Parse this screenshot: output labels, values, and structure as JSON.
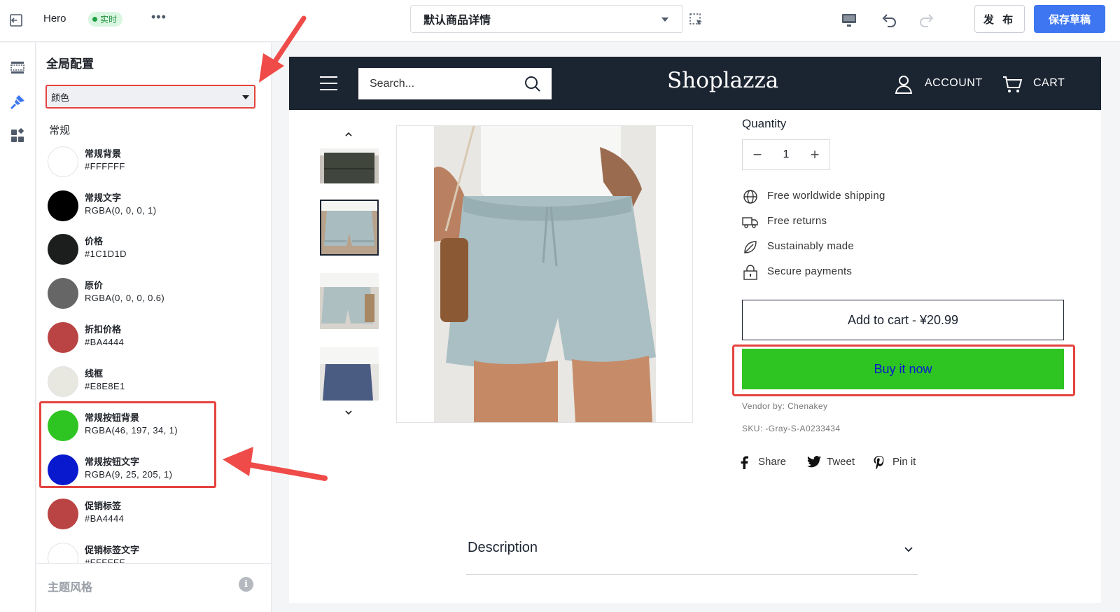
{
  "topbar": {
    "theme_name": "Hero",
    "live_badge": "实时",
    "more": "•••",
    "page_select": "默认商品详情",
    "publish_label": "发 布",
    "save_label": "保存草稿"
  },
  "panel": {
    "title": "全局配置",
    "section_select": "颜色",
    "group_label": "常规",
    "colors": [
      {
        "name": "常规背景",
        "value": "#FFFFFF",
        "swatch": "#FFFFFF"
      },
      {
        "name": "常规文字",
        "value": "RGBA(0, 0, 0, 1)",
        "swatch": "#000000"
      },
      {
        "name": "价格",
        "value": "#1C1D1D",
        "swatch": "#1C1D1D"
      },
      {
        "name": "原价",
        "value": "RGBA(0, 0, 0, 0.6)",
        "swatch": "#666666"
      },
      {
        "name": "折扣价格",
        "value": "#BA4444",
        "swatch": "#BA4444"
      },
      {
        "name": "线框",
        "value": "#E8E8E1",
        "swatch": "#E8E8E1"
      },
      {
        "name": "常规按钮背景",
        "value": "RGBA(46, 197, 34, 1)",
        "swatch": "#2EC522"
      },
      {
        "name": "常规按钮文字",
        "value": "RGBA(9, 25, 205, 1)",
        "swatch": "#0919CD"
      },
      {
        "name": "促销标签",
        "value": "#BA4444",
        "swatch": "#BA4444"
      },
      {
        "name": "促销标签文字",
        "value": "#FFFFFF",
        "swatch": "#FFFFFF"
      }
    ],
    "footer_label": "主题风格",
    "footer_info": "i"
  },
  "store": {
    "search_placeholder": "Search...",
    "logo": "Shoplazza",
    "account": "ACCOUNT",
    "cart": "CART",
    "quantity_label": "Quantity",
    "quantity_value": "1",
    "features": [
      {
        "icon": "globe-icon",
        "text": "Free worldwide shipping"
      },
      {
        "icon": "truck-icon",
        "text": "Free returns"
      },
      {
        "icon": "leaf-icon",
        "text": "Sustainably made"
      },
      {
        "icon": "lock-icon",
        "text": "Secure payments"
      }
    ],
    "add_to_cart": "Add to cart - ¥20.99",
    "buy_now": "Buy it now",
    "vendor": "Vendor by: Chenakey",
    "sku": "SKU: -Gray-S-A0233434",
    "social": [
      {
        "icon": "facebook-icon",
        "text": "Share"
      },
      {
        "icon": "twitter-icon",
        "text": "Tweet"
      },
      {
        "icon": "pinterest-icon",
        "text": "Pin it"
      }
    ],
    "description_label": "Description"
  },
  "colors": {
    "accent_blue": "#3D76F0",
    "highlight_red": "#E5433F",
    "store_header": "#1B2431",
    "buy_button_bg": "#2EC522",
    "buy_button_text": "#0919CD"
  }
}
